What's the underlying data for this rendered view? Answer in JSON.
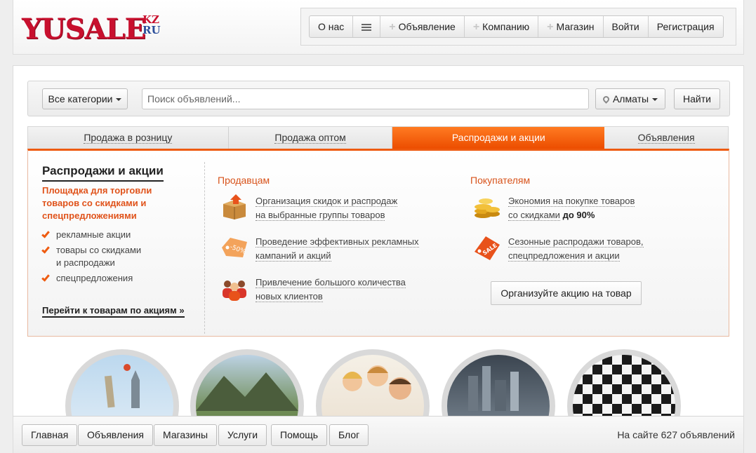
{
  "logo": {
    "main": "YUSALE",
    "kz": "KZ",
    "ru": "RU"
  },
  "topnav": {
    "about": "О нас",
    "ad": "Объявление",
    "company": "Компанию",
    "shop": "Магазин",
    "login": "Войти",
    "register": "Регистрация"
  },
  "search": {
    "category": "Все категории",
    "placeholder": "Поиск объявлений...",
    "city": "Алматы",
    "submit": "Найти"
  },
  "tabs": [
    "Продажа в розницу",
    "Продажа оптом",
    "Распродажи и акции",
    "Объявления"
  ],
  "promo": {
    "title": "Распродажи и акции",
    "subtitle": "Площадка для торговли товаров со скидками и спецпредложениями",
    "checks": [
      "рекламные акции",
      "товары со скидками",
      "и распродажи",
      "спецпредложения"
    ],
    "link": "Перейти к товарам по акциям",
    "link_arrow": "»",
    "sellers": {
      "heading": "Продавцам",
      "items": [
        [
          "Организация скидок и распродаж",
          "на выбранные группы товаров"
        ],
        [
          "Проведение эффективных рекламных",
          "кампаний и акций"
        ],
        [
          "Привлечение большого количества",
          "новых клиентов"
        ]
      ]
    },
    "buyers": {
      "heading": "Покупателям",
      "item1_line1": "Экономия на покупке товаров",
      "item1_line2": "со скидками",
      "item1_bold": "до 90%",
      "item2_line1": "Сезонные распродажи товаров,",
      "item2_line2": "спецпредложения и акции"
    },
    "button": "Организуйте акцию на товар",
    "icon_badges": {
      "discount": "-50%",
      "sale": "SALE"
    }
  },
  "footer": {
    "nav": [
      "Главная",
      "Объявления",
      "Магазины",
      "Услуги",
      "Помощь",
      "Блог"
    ],
    "stat": "На сайте 627 объявлений"
  },
  "colors": {
    "accent": "#ee5b10",
    "logo_red": "#c8102e",
    "logo_blue": "#2b4e9a"
  }
}
